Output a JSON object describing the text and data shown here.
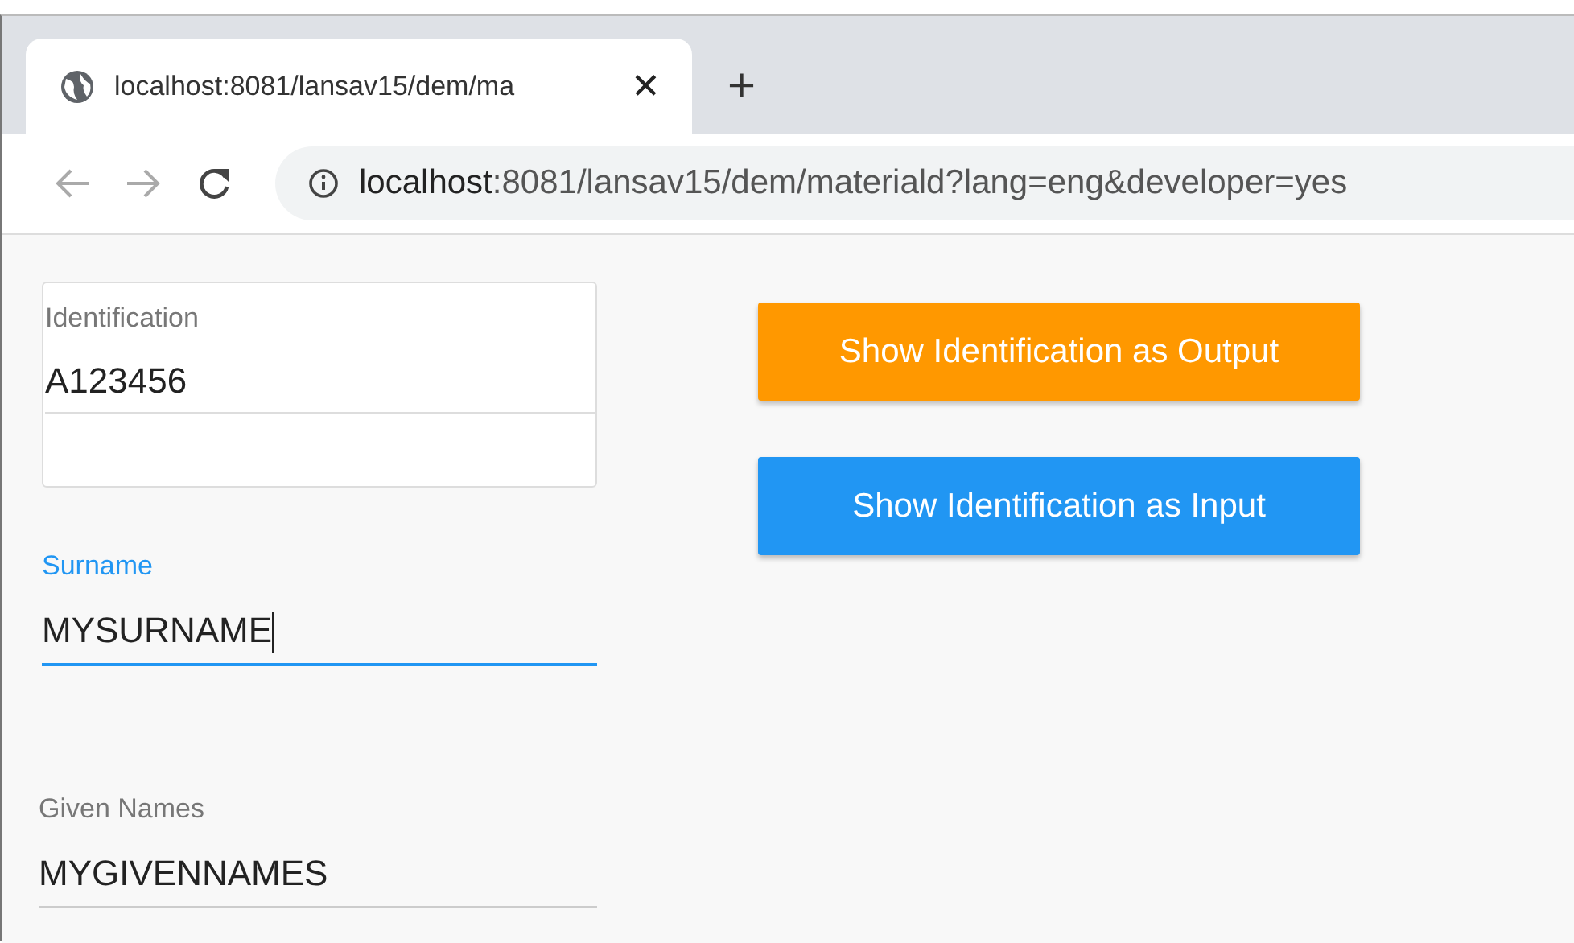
{
  "browser": {
    "tab_title": "localhost:8081/lansav15/dem/ma",
    "close_tab": "✕",
    "new_tab": "+",
    "address_host": "localhost",
    "address_rest": ":8081/lansav15/dem/materiald?lang=eng&developer=yes"
  },
  "fields": [
    {
      "kind": "boxed",
      "label": "Identification",
      "value": "A123456",
      "focused": false
    },
    {
      "kind": "underline",
      "label": "Surname",
      "value": "MYSURNAME",
      "focused": true
    },
    {
      "kind": "underline",
      "label": "Given Names",
      "value": "MYGIVENNAMES",
      "focused": false
    }
  ],
  "buttons": [
    {
      "label": "Show Identification as Output",
      "color": "#ff9800"
    },
    {
      "label": "Show Identification as Input",
      "color": "#2196f3"
    }
  ]
}
